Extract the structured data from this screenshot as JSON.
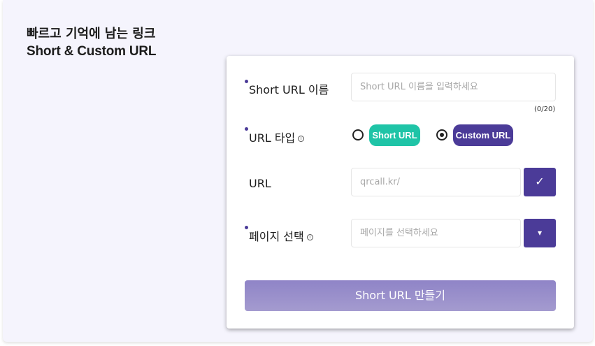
{
  "headline": {
    "line1": "빠르고 기억에 남는 링크",
    "line2": "Short & Custom URL"
  },
  "form": {
    "name_field": {
      "label": "Short URL 이름",
      "placeholder": "Short URL 이름을 입력하세요",
      "counter": "(0/20)"
    },
    "url_type": {
      "label": "URL 타입",
      "info_icon": "ⓘ",
      "options": [
        {
          "label": "Short URL",
          "selected": false,
          "color": "#1fc4a7"
        },
        {
          "label": "Custom URL",
          "selected": true,
          "color": "#4b3b98"
        }
      ]
    },
    "url_field": {
      "label": "URL",
      "placeholder": "qrcall.kr/",
      "confirm_icon": "✓"
    },
    "page_select": {
      "label": "페이지 선택",
      "info_icon": "ⓘ",
      "placeholder": "페이지를 선택하세요",
      "dropdown_icon": "▾"
    },
    "submit_label": "Short URL 만들기"
  },
  "colors": {
    "accent": "#4b3b98",
    "teal": "#1fc4a7",
    "background": "#f5f4fd"
  }
}
